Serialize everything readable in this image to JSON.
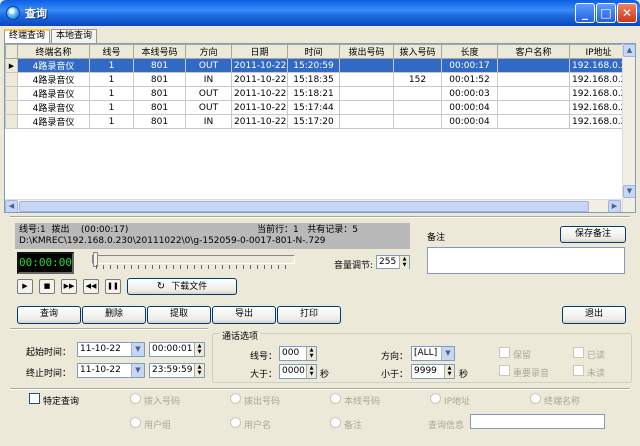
{
  "window": {
    "title": "查询"
  },
  "tabs": [
    "终端查询",
    "本地查询"
  ],
  "grid": {
    "columns": [
      "终端名称",
      "线号",
      "本线号码",
      "方向",
      "日期",
      "时间",
      "拨出号码",
      "拨入号码",
      "长度",
      "客户名称",
      "IP地址"
    ],
    "rows": [
      [
        "4路录音仪",
        "1",
        "801",
        "OUT",
        "2011-10-22",
        "15:20:59",
        "",
        "",
        "00:00:17",
        "",
        "192.168.0.23"
      ],
      [
        "4路录音仪",
        "1",
        "801",
        "IN",
        "2011-10-22",
        "15:18:35",
        "",
        "152",
        "00:01:52",
        "",
        "192.168.0.23"
      ],
      [
        "4路录音仪",
        "1",
        "801",
        "OUT",
        "2011-10-22",
        "15:18:21",
        "",
        "",
        "00:00:03",
        "",
        "192.168.0.23"
      ],
      [
        "4路录音仪",
        "1",
        "801",
        "OUT",
        "2011-10-22",
        "15:17:44",
        "",
        "",
        "00:00:04",
        "",
        "192.168.0.23"
      ],
      [
        "4路录音仪",
        "1",
        "801",
        "IN",
        "2011-10-22",
        "15:17:20",
        "",
        "",
        "00:00:04",
        "",
        "192.168.0.23"
      ]
    ]
  },
  "info": {
    "line1_left": "线号:1  拨出    (00:00:17)",
    "line1_right": "当前行：1   共有记录：5",
    "path": "D:\\KMREC\\192.168.0.230\\20111022\\0\\g-152059-0-0017-801-N-.729"
  },
  "note": {
    "label": "备注",
    "save_button": "保存备注"
  },
  "player": {
    "timer": "00:00:00",
    "volume_label": "音量调节:",
    "volume": "255",
    "download_button": "下载文件",
    "progress": 0
  },
  "actions": {
    "query": "查询",
    "delete": "删除",
    "extract": "提取",
    "export": "导出",
    "print": "打印",
    "exit": "退出"
  },
  "filters": {
    "start_label": "起始时间：",
    "start_date": "11-10-22",
    "start_time": "00:00:01",
    "end_label": "终止时间：",
    "end_date": "11-10-22",
    "end_time": "23:59:59",
    "group_title": "通话选项",
    "line_label": "线号：",
    "line_value": "000",
    "greater_label": "大于：",
    "greater_value": "0000",
    "sec1": "秒",
    "direction_label": "方向：",
    "direction_value": "[ALL]",
    "less_label": "小于：",
    "less_value": "9999",
    "sec2": "秒",
    "keep": "保留",
    "read": "已读",
    "important": "重要录音",
    "unread": "未读"
  },
  "specific": {
    "label": "特定查询",
    "options": [
      "拨入号码",
      "拨出号码",
      "本线号码",
      "IP地址",
      "终端名称",
      "用户组",
      "用户名",
      "备注"
    ],
    "query_info_label": "查询信息"
  }
}
